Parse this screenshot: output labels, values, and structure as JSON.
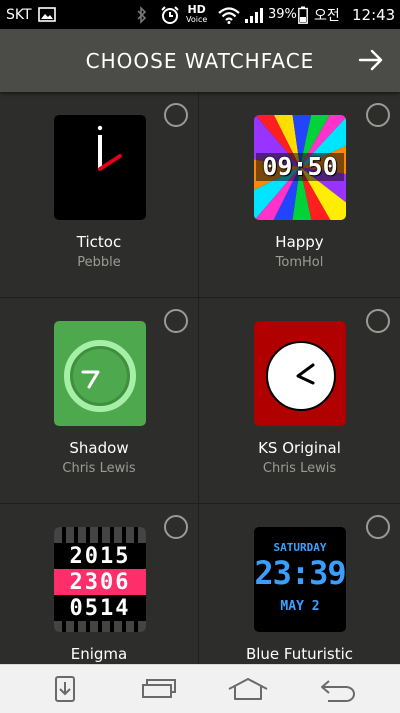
{
  "status_bar": {
    "carrier": "SKT",
    "hd_voice_top": "HD",
    "hd_voice_bottom": "Voice",
    "battery": "39%",
    "ampm": "오전",
    "time": "12:43"
  },
  "header": {
    "title": "CHOOSE WATCHFACE"
  },
  "watchfaces": [
    {
      "name": "Tictoc",
      "author": "Pebble"
    },
    {
      "name": "Happy",
      "author": "TomHol",
      "face_time": "09:50"
    },
    {
      "name": "Shadow",
      "author": "Chris Lewis"
    },
    {
      "name": "KS Original",
      "author": "Chris Lewis"
    },
    {
      "name": "Enigma",
      "author": "",
      "rows": [
        "2015",
        "2306",
        "0514"
      ]
    },
    {
      "name": "Blue Futuristic",
      "author": "",
      "day": "SATURDAY",
      "time": "23:39",
      "date": "MAY 2"
    }
  ],
  "colors": {
    "header_bg": "#4b4b48",
    "grid_bg": "#2d2d2b",
    "shadow_face": "#4ea84e",
    "ks_face": "#b00000",
    "enigma_band": "#ff2d6a",
    "blue_face": "#3aa0ff"
  }
}
